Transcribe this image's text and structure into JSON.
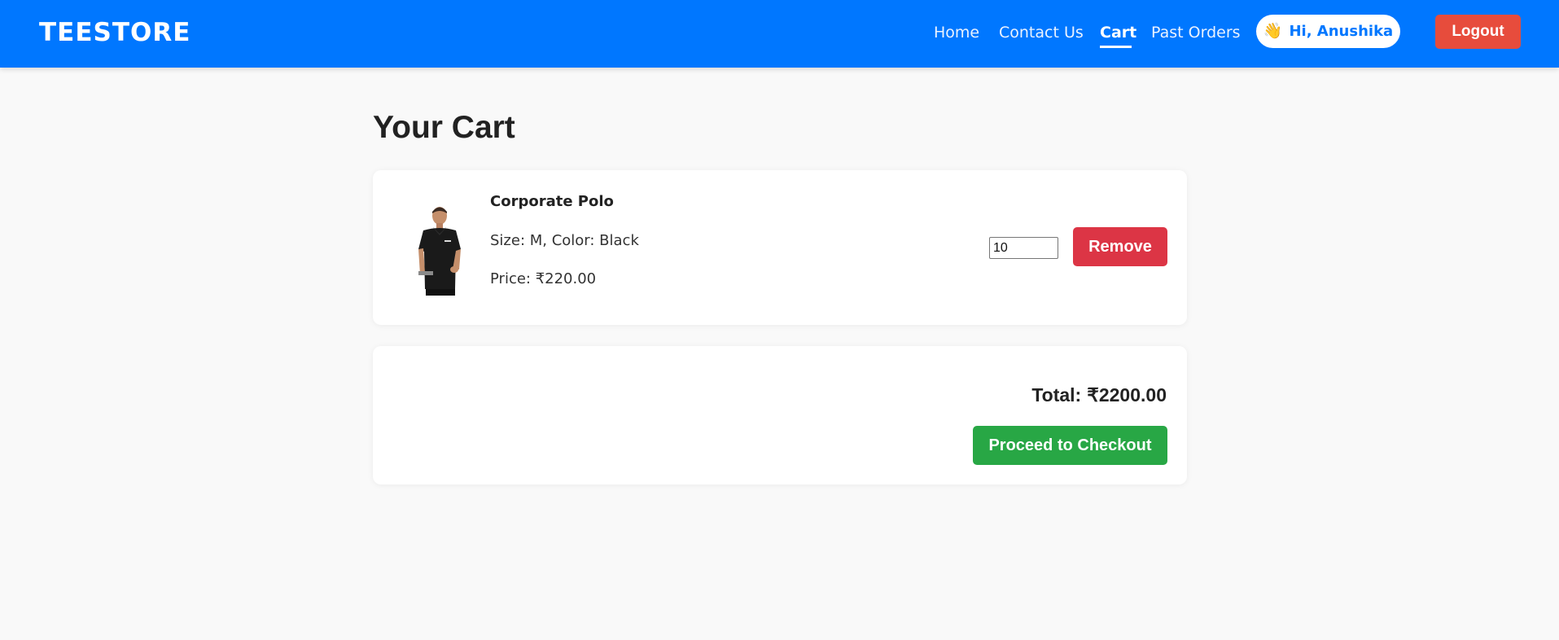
{
  "brand": {
    "name": "TEESTORE"
  },
  "nav": {
    "items": [
      {
        "label": "Home"
      },
      {
        "label": "Contact Us"
      },
      {
        "label": "Cart"
      },
      {
        "label": "Past Orders"
      }
    ],
    "active": "Cart",
    "greeting": {
      "icon": "👋",
      "text": "Hi, Anushika"
    },
    "logout_label": "Logout"
  },
  "page": {
    "title": "Your Cart"
  },
  "cart": {
    "items": [
      {
        "name": "Corporate Polo",
        "variant": "Size: M, Color: Black",
        "price": "Price: ₹220.00",
        "quantity": "10",
        "image_icon": "polo-shirt-model-image",
        "remove_label": "Remove"
      }
    ]
  },
  "summary": {
    "total_label": "Total:",
    "total_value": "₹2200.00",
    "checkout_label": "Proceed to Checkout"
  },
  "colors": {
    "navbar": "#0077ff",
    "logout": "#e74c3c",
    "remove": "#dc3545",
    "checkout": "#28a745",
    "background": "#f9f9f9"
  }
}
